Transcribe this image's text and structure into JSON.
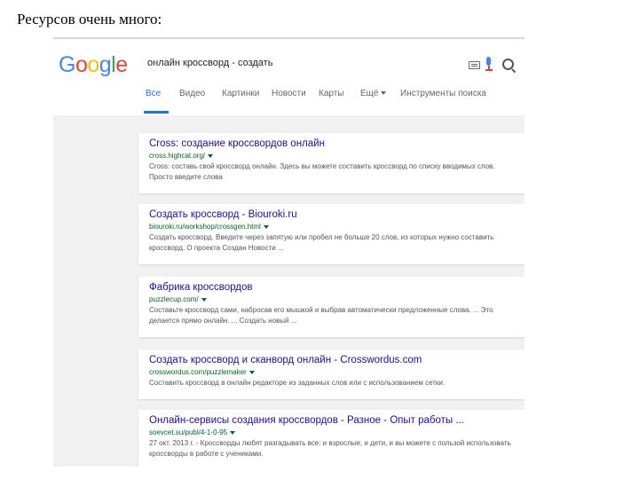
{
  "slide": {
    "title": "Ресурсов очень много:"
  },
  "google": {
    "logo_letters": [
      {
        "char": "G",
        "color": "#4285F4"
      },
      {
        "char": "o",
        "color": "#EA4335"
      },
      {
        "char": "o",
        "color": "#FBBC05"
      },
      {
        "char": "g",
        "color": "#4285F4"
      },
      {
        "char": "l",
        "color": "#34A853"
      },
      {
        "char": "e",
        "color": "#EA4335"
      }
    ],
    "search": {
      "query": "онлайн кроссворд - создать"
    },
    "icons": {
      "keyboard": "keyboard-icon",
      "mic": "mic-icon",
      "search": "search-icon"
    },
    "tabs": [
      {
        "label": "Все",
        "active": true
      },
      {
        "label": "Видео",
        "active": false
      },
      {
        "label": "Картинки",
        "active": false
      },
      {
        "label": "Новости",
        "active": false
      },
      {
        "label": "Карты",
        "active": false
      },
      {
        "label": "Ещё",
        "active": false,
        "dropdown": true
      },
      {
        "label": "Инструменты поиска",
        "active": false
      }
    ],
    "results": [
      {
        "title": "Cross: создание кроссвордов онлайн",
        "url": "cross.highcat.org/",
        "snippet": "Cross: составь свой кроссворд онлайн. Здесь вы можете составить кроссворд по списку вводимых слов. Просто введите слова"
      },
      {
        "title": "Создать кроссворд - Biouroki.ru",
        "url": "biouroki.ru/workshop/crossgen.html",
        "snippet": "Создать кроссворд. Введите через запятую или пробел не больше 20 слов, из которых нужно составить кроссворд. О проекта Создан Новости ..."
      },
      {
        "title": "Фабрика кроссвордов",
        "url": "puzzlecup.com/",
        "snippet": "Составьте кроссворд сами, набросав его мышкой и выбрав автоматически предложенные слова. ... Это делается прямо онлайн. ... Создать новый ..."
      },
      {
        "title": "Создать кроссворд и сканворд онлайн - Crosswordus.com",
        "url": "crosswordus.com/puzzlemaker",
        "snippet": "Составить кроссворд в онлайн редакторе из заданных слов или с использованием сетки."
      },
      {
        "title": "Онлайн-сервисы создания кроссвордов - Разное - Опыт работы ...",
        "url": "soevcet.su/publ/4-1-0-95",
        "snippet": "27 окт. 2013 г. - Кроссворды любят разгадывать все: и взрослые, и дети, и вы можете с пользой использовать кроссворды в работе с учениками."
      }
    ]
  }
}
